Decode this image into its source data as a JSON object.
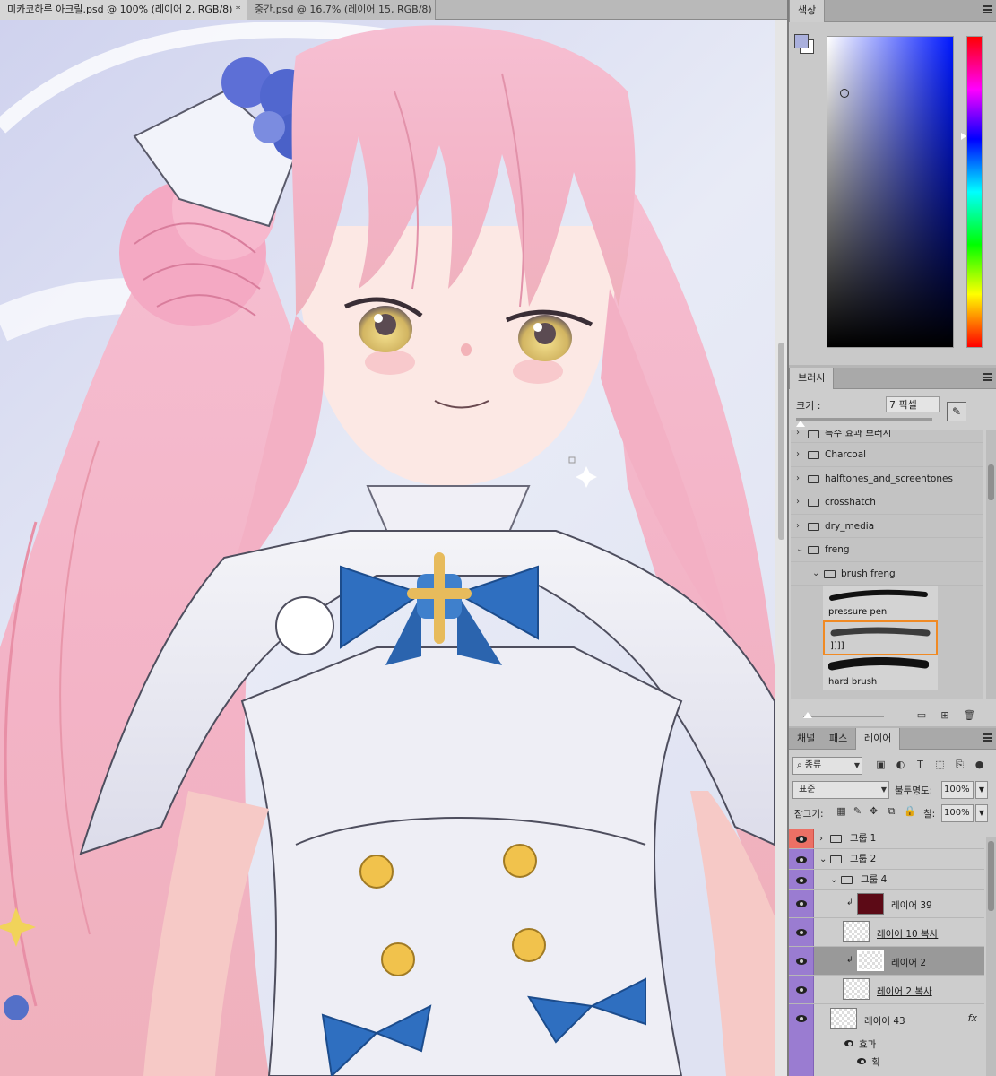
{
  "doc_tabs": [
    {
      "label": "미카코하루 아크릴.psd @ 100% (레이어 2, RGB/8) *",
      "close": "×",
      "active": true
    },
    {
      "label": "중간.psd @ 16.7% (레이어 15, RGB/8)",
      "close": "×",
      "active": false
    }
  ],
  "color_panel": {
    "tab": "색상",
    "foreground_color": "#aab0dd",
    "background_color": "#ffffff"
  },
  "brush_panel": {
    "tab": "브러시",
    "size_label": "크기 :",
    "size_value": "7 픽셀",
    "folders": [
      {
        "label": "특수 효과 브러시",
        "expanded": false
      },
      {
        "label": "Charcoal",
        "expanded": false
      },
      {
        "label": "halftones_and_screentones",
        "expanded": false
      },
      {
        "label": "crosshatch",
        "expanded": false
      },
      {
        "label": "dry_media",
        "expanded": false
      },
      {
        "label": "freng",
        "expanded": true
      }
    ],
    "subfolder": {
      "label": "brush freng",
      "expanded": true
    },
    "presets": [
      {
        "label": "pressure pen",
        "selected": false
      },
      {
        "label": "]]]]",
        "selected": true
      },
      {
        "label": "hard brush",
        "selected": false
      }
    ],
    "selection_color": "#f08a24"
  },
  "layers_panel": {
    "tabs": [
      "채널",
      "패스",
      "레이어"
    ],
    "active_tab": "레이어",
    "filter_label": "종류",
    "blend_mode": "표준",
    "opacity_label": "불투명도:",
    "opacity_value": "100%",
    "lock_label": "잠그기:",
    "fill_label": "칠:",
    "fill_value": "100%",
    "layers": [
      {
        "name": "그룹 1",
        "type": "group",
        "expanded": false,
        "eye_color": "red"
      },
      {
        "name": "그룹 2",
        "type": "group",
        "expanded": true,
        "eye_color": "violet"
      },
      {
        "name": "그룹 4",
        "type": "group",
        "expanded": true,
        "eye_color": "violet"
      },
      {
        "name": "레이어 39",
        "type": "layer",
        "clipped": true,
        "eye_color": "violet"
      },
      {
        "name": "레이어 10 복사",
        "type": "layer",
        "eye_color": "violet"
      },
      {
        "name": "레이어 2",
        "type": "layer",
        "clipped": true,
        "selected": true,
        "eye_color": "violet"
      },
      {
        "name": "레이어 2 복사",
        "type": "layer",
        "eye_color": "violet"
      },
      {
        "name": "레이어 43",
        "type": "layer",
        "fx": "fx",
        "eye_color": "violet"
      }
    ],
    "effects_label": "효과",
    "effect_item": "획"
  }
}
